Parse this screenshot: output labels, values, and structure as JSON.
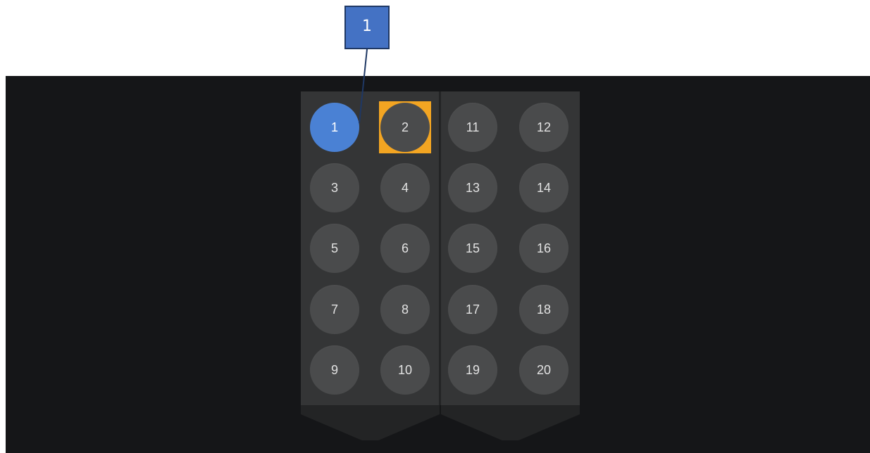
{
  "callout": {
    "label": "1"
  },
  "tray": {
    "left_column_vials": [
      "1",
      "2",
      "3",
      "4",
      "5",
      "6",
      "7",
      "8",
      "9",
      "10"
    ],
    "right_column_vials": [
      "11",
      "12",
      "13",
      "14",
      "15",
      "16",
      "17",
      "18",
      "19",
      "20"
    ],
    "selected_vial": "1",
    "focused_vial": "2"
  },
  "colors": {
    "background": "#151618",
    "holder": "#343536",
    "vial": "#4a4b4c",
    "selected_vial": "#4a81d4",
    "focus_frame": "#f3a522",
    "callout": "#4472c4"
  }
}
